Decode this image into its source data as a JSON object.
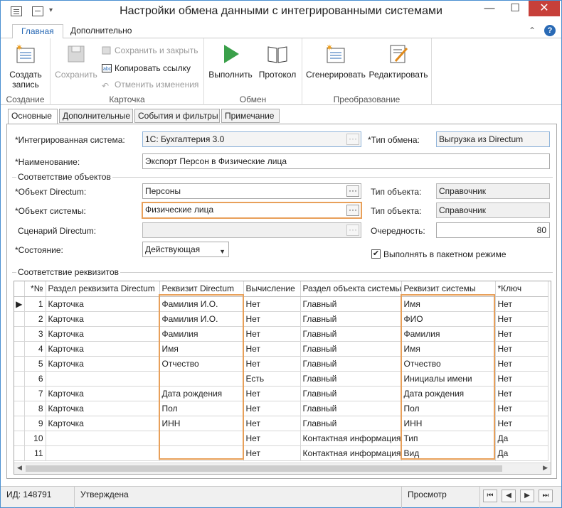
{
  "window": {
    "title": "Настройки обмена данными с интегрированными системами",
    "minimize": "—",
    "maximize": "☐",
    "close": "✕"
  },
  "ribbon": {
    "tabs": [
      "Главная",
      "Дополнительно"
    ],
    "help": "?",
    "collapse": "⌃",
    "groups": {
      "create": {
        "title": "Создание",
        "create_record": "Создать запись"
      },
      "card": {
        "title": "Карточка",
        "save": "Сохранить",
        "save_close": "Сохранить и закрыть",
        "copy_link": "Копировать ссылку",
        "undo": "Отменить изменения"
      },
      "exchange": {
        "title": "Обмен",
        "run": "Выполнить",
        "log": "Протокол"
      },
      "transform": {
        "title": "Преобразование",
        "generate": "Сгенерировать",
        "edit": "Редактировать"
      }
    }
  },
  "form_tabs": [
    "Основные",
    "Дополнительные",
    "События и фильтры",
    "Примечание"
  ],
  "form": {
    "integrated_system_label": "*Интегрированная система:",
    "integrated_system_value": "1С: Бухгалтерия 3.0",
    "exchange_type_label": "*Тип обмена:",
    "exchange_type_value": "Выгрузка из Directum",
    "name_label": "*Наименование:",
    "name_value": "Экспорт Персон в Физические лица",
    "objects_group": "Соответствие объектов",
    "directum_object_label": "*Объект Directum:",
    "directum_object_value": "Персоны",
    "object_type_label": "Тип объекта:",
    "object_type_value_1": "Справочник",
    "system_object_label": "*Объект системы:",
    "system_object_value": "Физические лица",
    "object_type_value_2": "Справочник",
    "scenario_label": "Сценарий Directum:",
    "scenario_value": "",
    "order_label": "Очередность:",
    "order_value": "80",
    "state_label": "*Состояние:",
    "state_value": "Действующая",
    "batch_mode_label": "Выполнять в пакетном режиме",
    "batch_mode_checked": "✔",
    "attributes_group": "Соответствие реквизитов"
  },
  "table": {
    "columns": [
      "*№",
      "Раздел реквизита Directum",
      "Реквизит Directum",
      "Вычисление",
      "Раздел объекта системы",
      "Реквизит системы",
      "*Ключ"
    ],
    "current_row_marker": "▶",
    "rows": [
      [
        "1",
        "Карточка",
        "Фамилия И.О.",
        "Нет",
        "Главный",
        "Имя",
        "Нет"
      ],
      [
        "2",
        "Карточка",
        "Фамилия И.О.",
        "Нет",
        "Главный",
        "ФИО",
        "Нет"
      ],
      [
        "3",
        "Карточка",
        "Фамилия",
        "Нет",
        "Главный",
        "Фамилия",
        "Нет"
      ],
      [
        "4",
        "Карточка",
        "Имя",
        "Нет",
        "Главный",
        "Имя",
        "Нет"
      ],
      [
        "5",
        "Карточка",
        "Отчество",
        "Нет",
        "Главный",
        "Отчество",
        "Нет"
      ],
      [
        "6",
        "",
        "",
        "Есть",
        "Главный",
        "Инициалы имени",
        "Нет"
      ],
      [
        "7",
        "Карточка",
        "Дата рождения",
        "Нет",
        "Главный",
        "Дата рождения",
        "Нет"
      ],
      [
        "8",
        "Карточка",
        "Пол",
        "Нет",
        "Главный",
        "Пол",
        "Нет"
      ],
      [
        "9",
        "Карточка",
        "ИНН",
        "Нет",
        "Главный",
        "ИНН",
        "Нет"
      ],
      [
        "10",
        "",
        "",
        "Нет",
        "Контактная информация",
        "Тип",
        "Да"
      ],
      [
        "11",
        "",
        "",
        "Нет",
        "Контактная информация",
        "Вид",
        "Да"
      ]
    ]
  },
  "status": {
    "id": "ИД: 148791",
    "state": "Утверждена",
    "mode": "Просмотр",
    "nav": [
      "⏮",
      "◀",
      "▶",
      "⏭"
    ]
  },
  "colors": {
    "accent": "#2a6ab5",
    "highlight": "#e8a05a",
    "run_green": "#3aa04a"
  }
}
